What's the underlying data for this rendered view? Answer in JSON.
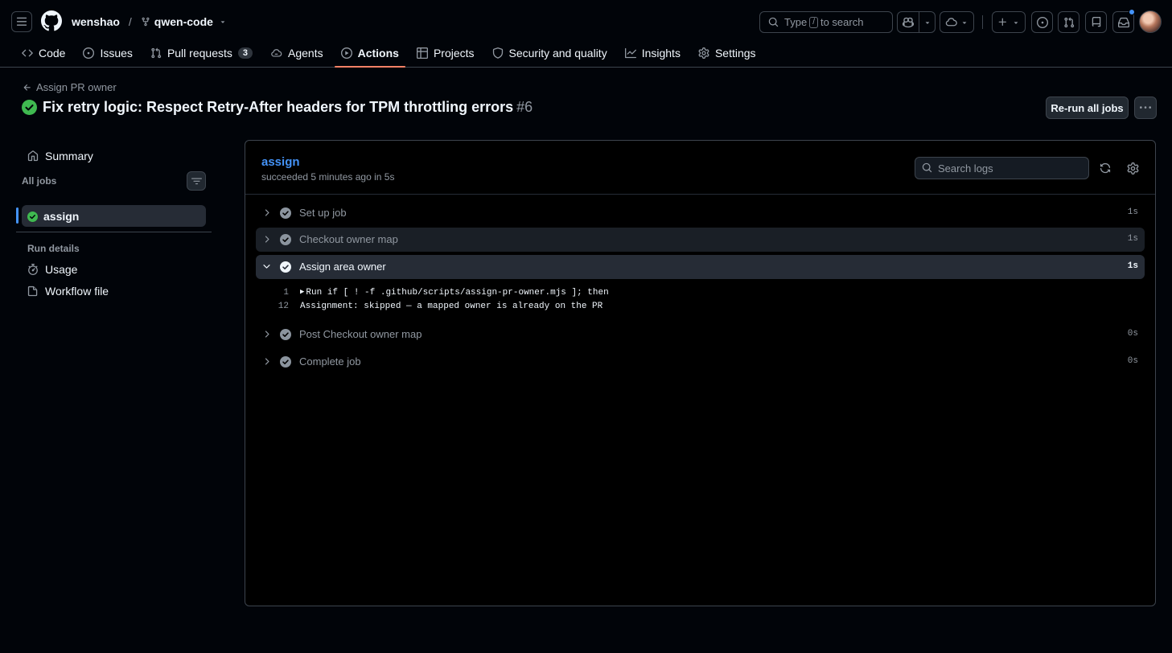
{
  "header": {
    "owner": "wenshao",
    "separator": "/",
    "repo": "qwen-code",
    "search_prefix": "Type",
    "search_key": "/",
    "search_suffix": "to search"
  },
  "repo_nav": {
    "tabs": [
      {
        "label": "Code",
        "icon": "code-icon"
      },
      {
        "label": "Issues",
        "icon": "issue-icon"
      },
      {
        "label": "Pull requests",
        "icon": "pull-request-icon",
        "count": "3"
      },
      {
        "label": "Agents",
        "icon": "agent-icon"
      },
      {
        "label": "Actions",
        "icon": "play-icon",
        "active": true
      },
      {
        "label": "Projects",
        "icon": "table-icon"
      },
      {
        "label": "Security and quality",
        "icon": "shield-icon"
      },
      {
        "label": "Insights",
        "icon": "graph-icon"
      },
      {
        "label": "Settings",
        "icon": "gear-icon"
      }
    ]
  },
  "run": {
    "back_label": "Assign PR owner",
    "title": "Fix retry logic: Respect Retry-After headers for TPM throttling errors",
    "number": "#6",
    "rerun_label": "Re-run all jobs"
  },
  "sidebar": {
    "summary": "Summary",
    "all_jobs": "All jobs",
    "jobs": [
      {
        "label": "assign",
        "status": "success"
      }
    ],
    "run_details": "Run details",
    "details": [
      {
        "label": "Usage",
        "icon": "stopwatch-icon"
      },
      {
        "label": "Workflow file",
        "icon": "file-icon"
      }
    ]
  },
  "job": {
    "name": "assign",
    "status_text": "succeeded 5 minutes ago in 5s",
    "search_placeholder": "Search logs",
    "steps": [
      {
        "name": "Set up job",
        "duration": "1s"
      },
      {
        "name": "Checkout owner map",
        "duration": "1s"
      },
      {
        "name": "Assign area owner",
        "duration": "1s",
        "expanded": true
      },
      {
        "name": "Post Checkout owner map",
        "duration": "0s"
      },
      {
        "name": "Complete job",
        "duration": "0s"
      }
    ],
    "log_lines": [
      {
        "num": "1",
        "text": "Run if [ ! -f .github/scripts/assign-pr-owner.mjs ]; then",
        "collapsible": true
      },
      {
        "num": "12",
        "text": "Assignment: skipped — a mapped owner is already on the PR",
        "collapsible": false
      }
    ]
  },
  "colors": {
    "accent_link": "#4493f8",
    "success": "#3fb950",
    "active_tab": "#f78166"
  }
}
